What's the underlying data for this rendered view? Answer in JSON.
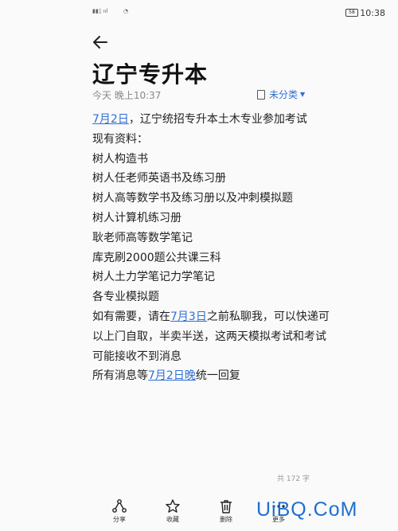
{
  "status_bar": {
    "time": "10:38",
    "battery": "58"
  },
  "note": {
    "title": "辽宁专升本",
    "meta": "今天 晚上10:37",
    "category": "未分类",
    "body": {
      "l1_date": "7月2日",
      "l1_rest": "，辽宁统招专升本土木专业参加考试",
      "l2": "现有资料：",
      "items": [
        "树人构造书",
        "树人任老师英语书及练习册",
        "树人高等数学书及练习册以及冲刺模拟题",
        "树人计算机练习册",
        "耿老师高等数学笔记",
        "库克刷2000题公共课三科",
        "树人土力学笔记力学笔记",
        "各专业模拟题"
      ],
      "p_pre": "如有需要，请在",
      "p_date": "7月3日",
      "p_post": "之前私聊我，可以快递可以上门自取，半卖半送，这两天模拟考试和考试可能接收不到消息",
      "last_pre": "所有消息等",
      "last_date": "7月2日晚",
      "last_post": "统一回复"
    },
    "word_count": "共 172 字"
  },
  "toolbar": {
    "share": "分享",
    "favorite": "收藏",
    "delete": "删除",
    "more": "更多"
  },
  "watermark": "UiBQ.CoM"
}
